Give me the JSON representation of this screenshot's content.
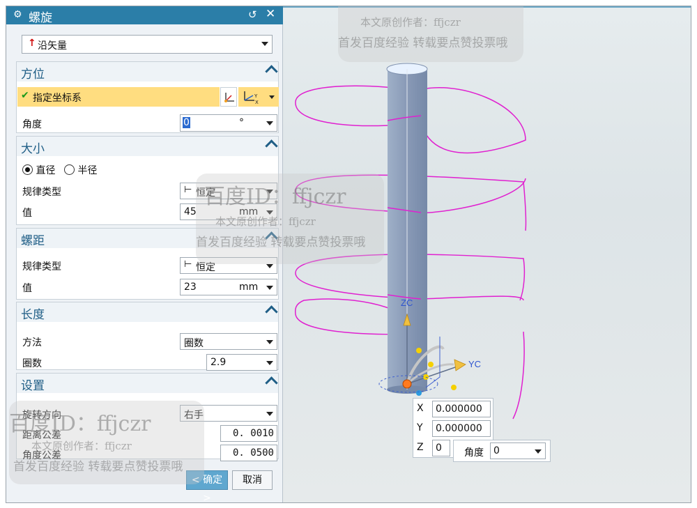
{
  "dialog": {
    "title": "螺旋",
    "direction_value": "沿矢量",
    "orientation": {
      "title": "方位",
      "specify_csys": "指定坐标系",
      "angle_label": "角度",
      "angle_value": "0",
      "angle_unit": "°"
    },
    "size": {
      "title": "大小",
      "radio_diameter": "直径",
      "radio_radius": "半径",
      "law_type_label": "规律类型",
      "law_type_value": "恒定",
      "value_label": "值",
      "value": "45",
      "unit": "mm"
    },
    "pitch": {
      "title": "螺距",
      "law_type_label": "规律类型",
      "law_type_value": "恒定",
      "value_label": "值",
      "value": "23",
      "unit": "mm"
    },
    "length": {
      "title": "长度",
      "method_label": "方法",
      "method_value": "圈数",
      "turns_label": "圈数",
      "turns_value": "2.9"
    },
    "settings": {
      "title": "设置",
      "rotation_label": "旋转方向",
      "rotation_value": "右手",
      "distance_tol_label": "距离公差",
      "distance_tol_value": "0. 0010",
      "angle_tol_label": "角度公差",
      "angle_tol_value": "0. 0500"
    },
    "ok_label": "< 确定 >",
    "cancel_label": "取消"
  },
  "viewport": {
    "zc_label": "ZC",
    "yc_label": "YC",
    "coords": [
      {
        "axis": "X",
        "value": "0.000000"
      },
      {
        "axis": "Y",
        "value": "0.000000"
      },
      {
        "axis": "Z",
        "value": "0"
      }
    ],
    "angle_popup_label": "角度",
    "angle_popup_value": "0"
  },
  "watermark": {
    "baidu_id": "百度ID：ffjczr",
    "author": "本文原创作者：ffjczr",
    "note": "首发百度经验 转载要点赞投票哦"
  },
  "colors": {
    "titlebar": "#2b7ea8",
    "section_title": "#1f5e86",
    "highlight_row": "#ffdd80",
    "helix": "#e020d0",
    "cylinder": "#8ea0bb"
  }
}
